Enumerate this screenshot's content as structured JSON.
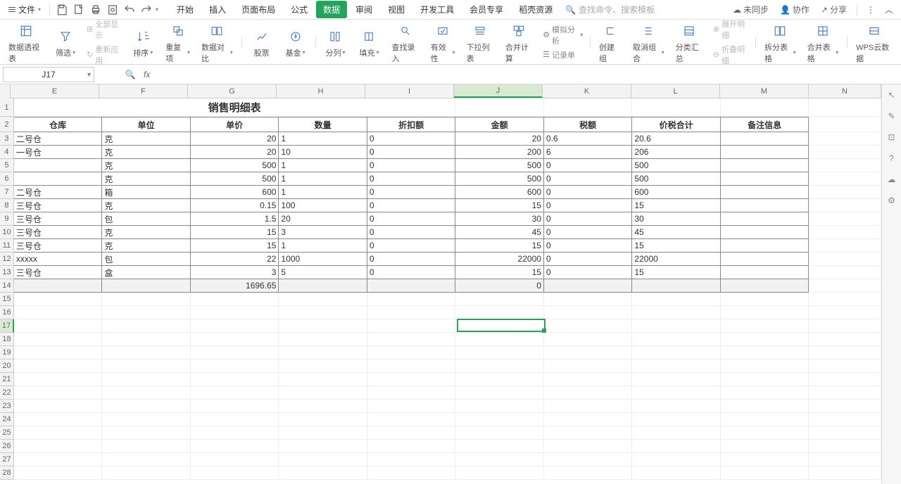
{
  "menubar": {
    "file": "文件",
    "tabs": [
      "开始",
      "插入",
      "页面布局",
      "公式",
      "数据",
      "审阅",
      "视图",
      "开发工具",
      "会员专享",
      "稻壳资源"
    ],
    "active_tab": 4,
    "search_hint": "查找命令、搜索模板",
    "right": {
      "unsynced": "未同步",
      "collab": "协作",
      "share": "分享"
    }
  },
  "ribbon": {
    "pivot": "数据透视表",
    "filter": "筛选",
    "show_all": "全部显示",
    "reapply": "重新应用",
    "sort": "排序",
    "dedupe": "重复项",
    "compare": "数据对比",
    "stock": "股票",
    "fund": "基金",
    "split": "分列",
    "fill": "填充",
    "findinput": "查找录入",
    "validity": "有效性",
    "dropdown": "下拉列表",
    "consolidate": "合并计算",
    "simulate": "模拟分析",
    "recordform": "记录单",
    "group": "创建组",
    "ungroup": "取消组合",
    "subtotal": "分类汇总",
    "expand": "展开明细",
    "collapse": "折叠明细",
    "splittbl": "拆分表格",
    "mergetbl": "合并表格",
    "wpscloud": "WPS云数据"
  },
  "namebox": "J17",
  "cols": [
    "E",
    "F",
    "G",
    "H",
    "I",
    "J",
    "K",
    "L",
    "M",
    "N"
  ],
  "title": "销售明细表",
  "headers": [
    "仓库",
    "单位",
    "单价",
    "数量",
    "折扣额",
    "金额",
    "税额",
    "价税合计",
    "备注信息"
  ],
  "rows": [
    {
      "n": 3,
      "cangku": "二号仓",
      "danwei": "克",
      "danjia": "20",
      "shuliang": "1",
      "zhekou": "0",
      "jine": "20",
      "shuie": "0.6",
      "heji": "20.6"
    },
    {
      "n": 4,
      "cangku": "一号仓",
      "danwei": "克",
      "danjia": "20",
      "shuliang": "10",
      "zhekou": "0",
      "jine": "200",
      "shuie": "6",
      "heji": "206"
    },
    {
      "n": 5,
      "cangku": "",
      "danwei": "克",
      "danjia": "500",
      "shuliang": "1",
      "zhekou": "0",
      "jine": "500",
      "shuie": "0",
      "heji": "500"
    },
    {
      "n": 6,
      "cangku": "",
      "danwei": "克",
      "danjia": "500",
      "shuliang": "1",
      "zhekou": "0",
      "jine": "500",
      "shuie": "0",
      "heji": "500"
    },
    {
      "n": 7,
      "cangku": "二号仓",
      "danwei": "箱",
      "danjia": "600",
      "shuliang": "1",
      "zhekou": "0",
      "jine": "600",
      "shuie": "0",
      "heji": "600"
    },
    {
      "n": 8,
      "cangku": "三号仓",
      "danwei": "克",
      "danjia": "0.15",
      "shuliang": "100",
      "zhekou": "0",
      "jine": "15",
      "shuie": "0",
      "heji": "15"
    },
    {
      "n": 9,
      "cangku": "三号仓",
      "danwei": "包",
      "danjia": "1.5",
      "shuliang": "20",
      "zhekou": "0",
      "jine": "30",
      "shuie": "0",
      "heji": "30"
    },
    {
      "n": 10,
      "cangku": "三号仓",
      "danwei": "克",
      "danjia": "15",
      "shuliang": "3",
      "zhekou": "0",
      "jine": "45",
      "shuie": "0",
      "heji": "45"
    },
    {
      "n": 11,
      "cangku": "三号仓",
      "danwei": "克",
      "danjia": "15",
      "shuliang": "1",
      "zhekou": "0",
      "jine": "15",
      "shuie": "0",
      "heji": "15"
    },
    {
      "n": 12,
      "cangku": "xxxxx",
      "danwei": "包",
      "danjia": "22",
      "shuliang": "1000",
      "zhekou": "0",
      "jine": "22000",
      "shuie": "0",
      "heji": "22000"
    },
    {
      "n": 13,
      "cangku": "三号仓",
      "danwei": "盒",
      "danjia": "3",
      "shuliang": "5",
      "zhekou": "0",
      "jine": "15",
      "shuie": "0",
      "heji": "15"
    }
  ],
  "total_row": {
    "n": 14,
    "danjia": "1696.65",
    "jine": "0"
  },
  "empty_rows": [
    15,
    16,
    17,
    18,
    19,
    20,
    21,
    22,
    23,
    24,
    25,
    26,
    27,
    28
  ],
  "selected": {
    "col": "J",
    "row": 17
  }
}
